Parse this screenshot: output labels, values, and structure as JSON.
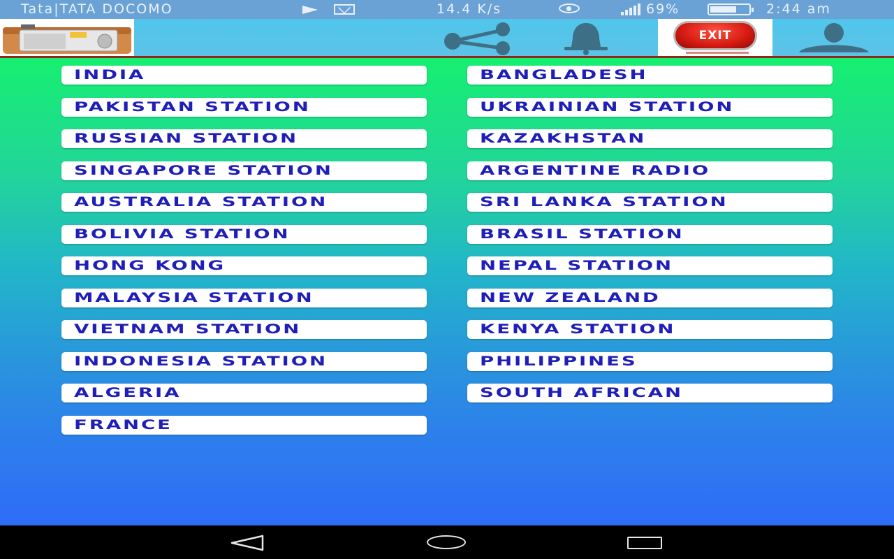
{
  "status_bar": {
    "carrier": "Tata|TATA DOCOMO",
    "speed": "14.4 K/s",
    "battery": "69%",
    "battery_level": 0.69,
    "time": "2:44 am"
  },
  "toolbar": {
    "exit_label": "EXIT"
  },
  "stations": {
    "left": [
      "INDIA",
      "PAKISTAN STATION",
      "RUSSIAN STATION",
      "SINGAPORE STATION",
      "AUSTRALIA STATION",
      "BOLIVIA STATION",
      "HONG KONG",
      "MALAYSIA STATION",
      "VIETNAM STATION",
      "INDONESIA STATION",
      "ALGERIA",
      "FRANCE"
    ],
    "right": [
      "BANGLADESH",
      "UKRAINIAN STATION",
      "KAZAKHSTAN",
      "ARGENTINE RADIO",
      "SRI LANKA STATION",
      "BRASIL STATION",
      "NEPAL STATION",
      "NEW ZEALAND",
      "KENYA STATION",
      "PHILIPPINES",
      "SOUTH AFRICAN"
    ]
  },
  "colors": {
    "button_text": "#1f1fb8",
    "gradient_top": "#16ef70",
    "gradient_bottom": "#2f6cf7",
    "toolbar": "#4fc6ea"
  },
  "icons": [
    "radio-logo",
    "share-icon",
    "bell-icon",
    "exit-icon",
    "user-icon",
    "back-icon",
    "home-icon",
    "recents-icon"
  ]
}
